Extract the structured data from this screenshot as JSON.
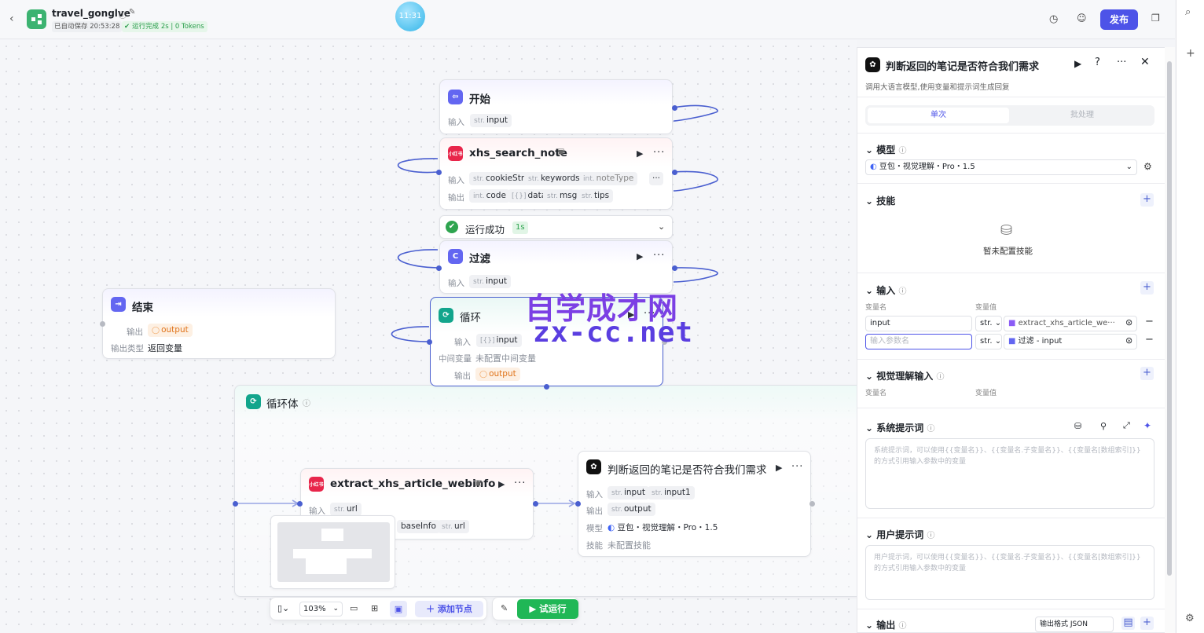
{
  "header": {
    "app_title": "travel_gonglve",
    "autosave": "已自动保存 20:53:28",
    "run_status": "运行完成 2s | 0 Tokens",
    "clock": "11:31",
    "publish": "发布"
  },
  "nodes": {
    "start": {
      "title": "开始",
      "input_label": "输入",
      "inputs": [
        {
          "type": "str.",
          "name": "input"
        }
      ]
    },
    "xhs_search": {
      "title": "xhs_search_note",
      "brand": "小红书",
      "input_label": "输入",
      "output_label": "输出",
      "inputs": [
        {
          "type": "str.",
          "name": "cookieStr"
        },
        {
          "type": "str.",
          "name": "keywords"
        },
        {
          "type": "int.",
          "name": "noteType"
        }
      ],
      "outputs": [
        {
          "type": "int.",
          "name": "code"
        },
        {
          "type": "[{}]",
          "name": "data"
        },
        {
          "type": "str.",
          "name": "msg"
        },
        {
          "type": "str.",
          "name": "tips"
        }
      ]
    },
    "run_success": {
      "text": "运行成功",
      "time": "1s"
    },
    "filter": {
      "title": "过滤",
      "input_label": "输入",
      "inputs": [
        {
          "type": "str.",
          "name": "input"
        }
      ]
    },
    "end": {
      "title": "结束",
      "output_label": "输出",
      "output": "output",
      "type_label": "输出类型",
      "type_value": "返回变量"
    },
    "loop": {
      "title": "循环",
      "input_label": "输入",
      "input": {
        "type": "[{}]",
        "name": "input"
      },
      "mid_label": "中间变量",
      "mid_value": "未配置中间变量",
      "output_label": "输出",
      "output": "output"
    },
    "loop_body": {
      "title": "循环体"
    },
    "extract": {
      "title": "extract_xhs_article_webinfo",
      "brand": "小红书",
      "input_label": "输入",
      "inputs": [
        {
          "type": "str.",
          "name": "url"
        }
      ],
      "outputs": [
        {
          "type": "",
          "name": "baseInfo"
        },
        {
          "type": "str.",
          "name": "url"
        }
      ]
    },
    "judge": {
      "title": "判断返回的笔记是否符合我们需求",
      "input_label": "输入",
      "output_label": "输出",
      "model_label": "模型",
      "skill_label": "技能",
      "inputs": [
        {
          "type": "str.",
          "name": "input"
        },
        {
          "type": "str.",
          "name": "input1"
        }
      ],
      "outputs": [
        {
          "type": "str.",
          "name": "output"
        }
      ],
      "model": "豆包・视觉理解・Pro・1.5",
      "skill": "未配置技能"
    }
  },
  "toolbar": {
    "zoom": "103%",
    "add_node": "添加节点",
    "trial_run": "试运行"
  },
  "panel": {
    "title": "判断返回的笔记是否符合我们需求",
    "subtitle": "调用大语言模型,使用变量和提示词生成回复",
    "tabs": [
      "单次",
      "批处理"
    ],
    "model_section": "模型",
    "model_value": "豆包・视觉理解・Pro・1.5",
    "skill_section": "技能",
    "skill_empty": "暂未配置技能",
    "input_section": "输入",
    "col_name": "变量名",
    "col_value": "变量值",
    "input_rows": [
      {
        "name": "input",
        "type": "str.",
        "value": "extract_xhs_article_we···"
      },
      {
        "name": "",
        "placeholder": "输入参数名",
        "type": "str.",
        "value": "过滤 - input"
      }
    ],
    "vision_section": "视觉理解输入",
    "vision_col_name": "变量名",
    "vision_col_value": "变量值",
    "system_section": "系统提示词",
    "system_placeholder": "系统提示词，可以使用{{变量名}}、{{变量名.子变量名}}、{{变量名[数组索引]}}的方式引用输入参数中的变量",
    "user_section": "用户提示词",
    "user_placeholder": "用户提示词，可以使用{{变量名}}、{{变量名.子变量名}}、{{变量名[数组索引]}}的方式引用输入参数中的变量",
    "output_section": "输出",
    "output_format": "输出格式 JSON"
  },
  "watermark": {
    "line1": "自学成才网",
    "line2": "zx-cc.net"
  }
}
